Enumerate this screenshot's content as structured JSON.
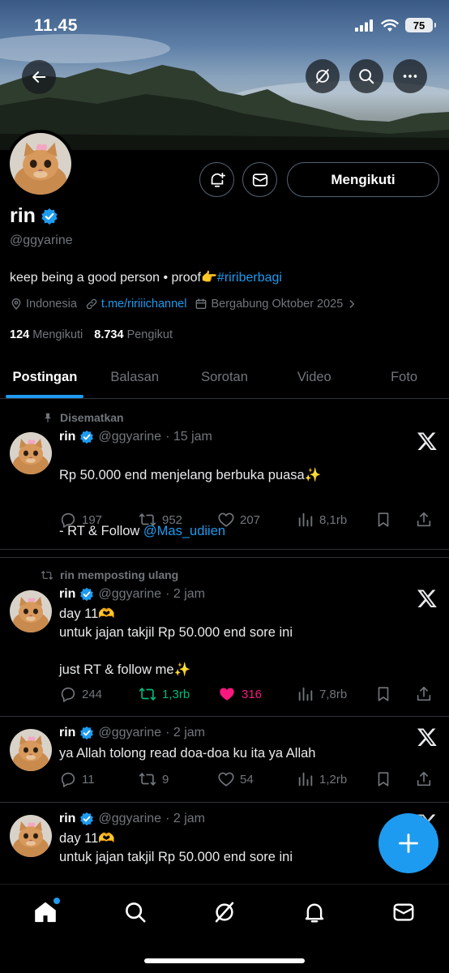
{
  "status_bar": {
    "time": "11.45",
    "battery": "75"
  },
  "profile": {
    "name": "rin",
    "handle": "@ggyarine",
    "bio_text": "keep being a good person • proof👉",
    "bio_hashtag": "#ririberbagi",
    "location": "Indonesia",
    "website": "t.me/ririiichannel",
    "joined": "Bergabung Oktober 2025",
    "following_count": "124",
    "following_label": "Mengikuti",
    "followers_count": "8.734",
    "followers_label": "Pengikut",
    "follow_button": "Mengikuti"
  },
  "tabs": [
    {
      "label": "Postingan",
      "active": true
    },
    {
      "label": "Balasan"
    },
    {
      "label": "Sorotan"
    },
    {
      "label": "Video"
    },
    {
      "label": "Foto"
    }
  ],
  "posts": [
    {
      "context": "Disematkan",
      "name": "rin",
      "handle": "@ggyarine",
      "time": "· 15 jam",
      "text": "Rp 50.000 end menjelang berbuka puasa✨",
      "text2": "- RT & Follow ",
      "mention": "@Mas_udiien",
      "replies": "197",
      "reposts": "952",
      "likes": "207",
      "views": "8,1rb"
    },
    {
      "context": "rin memposting ulang",
      "name": "rin",
      "handle": "@ggyarine",
      "time": "· 2 jam",
      "text": "day 11🫶\nuntuk jajan takjil Rp 50.000 end sore ini\n\njust RT & follow me✨",
      "replies": "244",
      "reposts": "1,3rb",
      "likes": "316",
      "views": "7,8rb",
      "reposted": true,
      "liked": true
    },
    {
      "name": "rin",
      "handle": "@ggyarine",
      "time": "· 2 jam",
      "text": "ya Allah tolong read doa-doa ku ita ya Allah",
      "replies": "11",
      "reposts": "9",
      "likes": "54",
      "views": "1,2rb"
    },
    {
      "name": "rin",
      "handle": "@ggyarine",
      "time": "· 2 jam",
      "text": "day 11🫶\nuntuk jajan takjil Rp 50.000 end sore ini"
    }
  ],
  "colors": {
    "accent": "#1d9bf0",
    "repost_active": "#00ba7c",
    "like_active": "#f91880",
    "muted": "#71767b"
  },
  "icons": [
    "back-arrow-icon",
    "grok-icon",
    "search-icon",
    "more-icon",
    "notification-bell-icon",
    "mail-icon",
    "verified-badge-icon",
    "location-icon",
    "link-icon",
    "calendar-icon",
    "pin-icon",
    "repost-icon",
    "x-logo-icon",
    "reply-icon",
    "like-icon",
    "views-icon",
    "bookmark-icon",
    "share-icon",
    "plus-icon",
    "home-icon",
    "bell-icon"
  ]
}
